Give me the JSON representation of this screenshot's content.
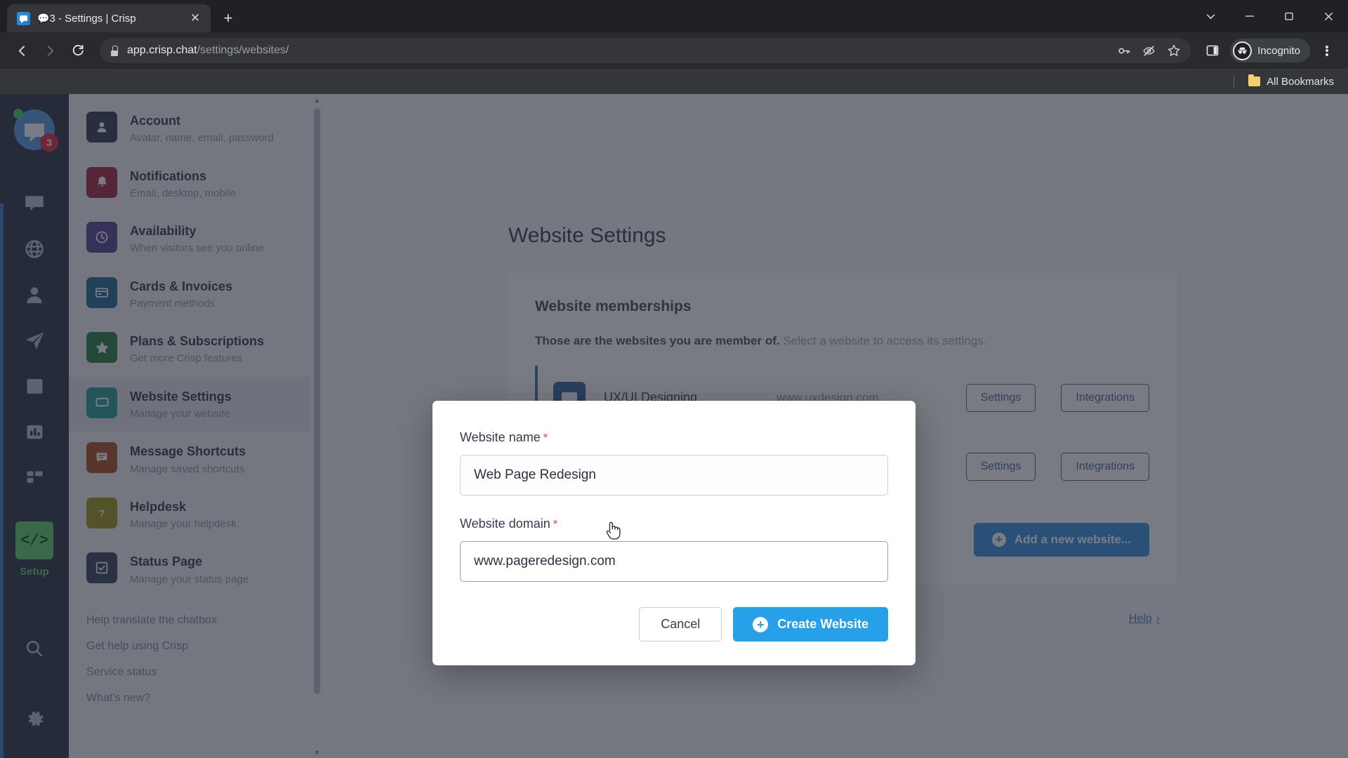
{
  "browser": {
    "tab": {
      "title": "3 - Settings | Crisp",
      "favicon": "crisp-chat-icon",
      "close_icon": "close-icon"
    },
    "new_tab_icon": "plus-icon",
    "window_controls": [
      "chevron-down-icon",
      "minimize-icon",
      "maximize-icon",
      "close-icon"
    ],
    "nav": {
      "back_icon": "arrow-left-icon",
      "forward_icon": "arrow-right-icon",
      "reload_icon": "reload-icon"
    },
    "omnibox": {
      "lock_icon": "lock-icon",
      "url_host": "app.crisp.chat",
      "url_path": "/settings/websites/",
      "icons": [
        "key-icon",
        "eye-slash-icon",
        "star-icon"
      ]
    },
    "toolbar_right": {
      "side_panel_icon": "side-panel-icon",
      "profile_label": "Incognito",
      "profile_icon": "incognito-icon",
      "menu_icon": "kebab-menu-icon"
    },
    "bookmarks": {
      "folder_icon": "folder-icon",
      "label": "All Bookmarks"
    }
  },
  "rail": {
    "avatar": {
      "badge": "3",
      "status": "online"
    },
    "icons": [
      {
        "name": "chat-bubble-icon"
      },
      {
        "name": "globe-icon"
      },
      {
        "name": "contacts-icon"
      },
      {
        "name": "campaigns-icon"
      },
      {
        "name": "knowledge-book-icon"
      },
      {
        "name": "analytics-icon"
      },
      {
        "name": "plugins-grid-icon"
      }
    ],
    "setup": {
      "label": "Setup",
      "icon": "code-brackets-icon"
    },
    "bottom_icons": [
      {
        "name": "search-icon"
      },
      {
        "name": "gear-icon"
      }
    ]
  },
  "settings_nav": {
    "items": [
      {
        "title": "Account",
        "subtitle": "Avatar, name, email, password",
        "icon": "person-icon",
        "color": "#2b3448",
        "active": false
      },
      {
        "title": "Notifications",
        "subtitle": "Email, desktop, mobile",
        "icon": "bell-icon",
        "color": "#9d1b38",
        "active": false
      },
      {
        "title": "Availability",
        "subtitle": "When visitors see you online",
        "icon": "clock-icon",
        "color": "#4b3c8c",
        "active": false
      },
      {
        "title": "Cards & Invoices",
        "subtitle": "Payment methods",
        "icon": "credit-card-icon",
        "color": "#14658c",
        "active": false
      },
      {
        "title": "Plans & Subscriptions",
        "subtitle": "Get more Crisp features",
        "icon": "star-icon",
        "color": "#1f7a3a",
        "active": false
      },
      {
        "title": "Website Settings",
        "subtitle": "Manage your website",
        "icon": "monitor-icon",
        "color": "#1a9b94",
        "active": true
      },
      {
        "title": "Message Shortcuts",
        "subtitle": "Manage saved shortcuts",
        "icon": "message-lines-icon",
        "color": "#a8441b",
        "active": false
      },
      {
        "title": "Helpdesk",
        "subtitle": "Manage your helpdesk",
        "icon": "question-icon",
        "color": "#9b9012",
        "active": false
      },
      {
        "title": "Status Page",
        "subtitle": "Manage your status page",
        "icon": "check-square-icon",
        "color": "#2e3b52",
        "active": false
      }
    ],
    "links": [
      "Help translate the chatbox",
      "Get help using Crisp",
      "Service status",
      "What's new?"
    ],
    "scrollbar": {
      "up_icon": "chevron-up-icon",
      "down_icon": "chevron-down-icon"
    }
  },
  "main": {
    "page_title": "Website Settings",
    "section_title": "Website memberships",
    "description_bold": "Those are the websites you are member of.",
    "description_rest": " Select a website to access its settings.",
    "websites": [
      {
        "name": "UX/UI Designing",
        "domain": "www.uxdesign.com",
        "icon": "website-chat-icon",
        "settings_label": "Settings",
        "integrations_label": "Integrations"
      },
      {
        "name": "",
        "domain": "",
        "icon": "website-chat-icon",
        "settings_label": "Settings",
        "integrations_label": "Integrations"
      }
    ],
    "add_button": {
      "label": "Add a new website...",
      "icon": "plus-circle-icon"
    },
    "help_link": {
      "label": "Help",
      "chevron": "›"
    }
  },
  "modal": {
    "name_field": {
      "label": "Website name",
      "required_mark": "*",
      "value": "Web Page Redesign",
      "placeholder": "Website name"
    },
    "domain_field": {
      "label": "Website domain",
      "required_mark": "*",
      "value": "www.pageredesign.com",
      "placeholder": "Website domain"
    },
    "cancel_label": "Cancel",
    "create_label": "Create Website",
    "create_icon": "plus-circle-icon"
  },
  "colors": {
    "accent_blue": "#26a0e8",
    "add_button_blue": "#2a8fdd",
    "required_red": "#e4435e",
    "rail_bg": "#242b3d",
    "setup_green": "#55cc66",
    "badge_red": "#e0213a"
  }
}
